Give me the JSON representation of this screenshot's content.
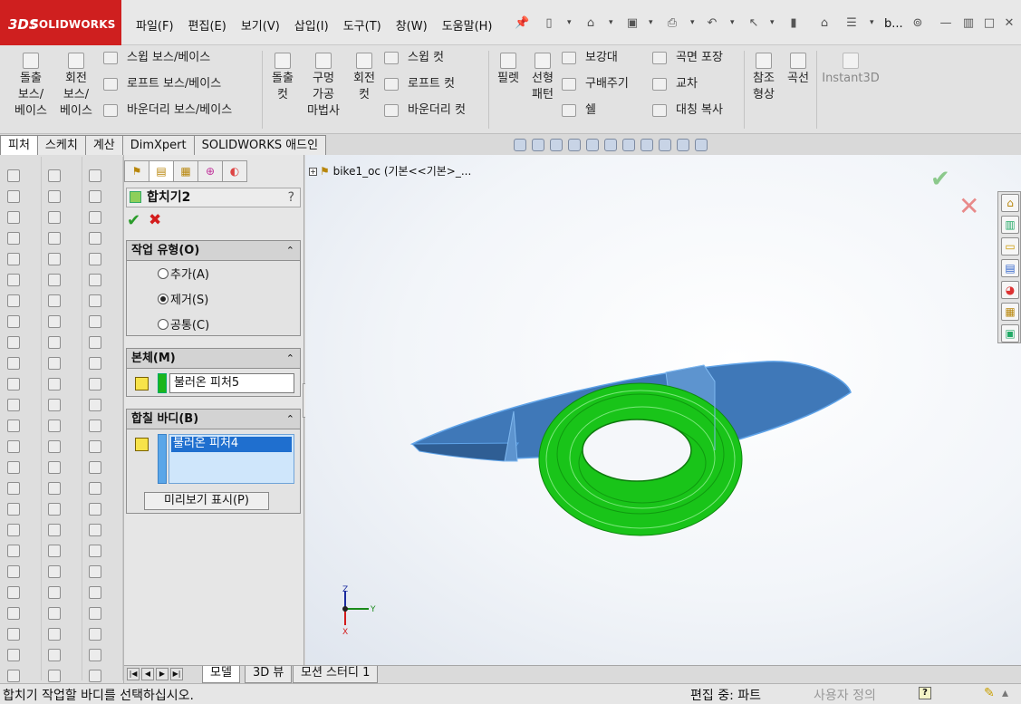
{
  "app": {
    "logo_mark": "3DS",
    "logo_text": "SOLIDWORKS",
    "doc_short": "b..."
  },
  "menu": [
    "파일(F)",
    "편집(E)",
    "보기(V)",
    "삽입(I)",
    "도구(T)",
    "창(W)",
    "도움말(H)"
  ],
  "commands": {
    "extrude_boss": "돌출\n보스/\n베이스",
    "revolve_boss": "회전\n보스/\n베이스",
    "sweep_boss": "스윕 보스/베이스",
    "loft_boss": "로프트 보스/베이스",
    "boundary_boss": "바운더리 보스/베이스",
    "extrude_cut": "돌출\n컷",
    "hole_wizard": "구멍\n가공\n마법사",
    "revolve_cut": "회전\n컷",
    "sweep_cut": "스윕 컷",
    "loft_cut": "로프트 컷",
    "boundary_cut": "바운더리 컷",
    "fillet": "필렛",
    "linear_pattern": "선형\n패턴",
    "rib": "보강대",
    "draft": "구배주기",
    "shell": "쉘",
    "wrap": "곡면 포장",
    "intersect": "교차",
    "mirror": "대칭 복사",
    "ref_geometry": "참조\n형상",
    "curves": "곡선",
    "instant3d": "Instant3D"
  },
  "command_tabs": [
    "피처",
    "스케치",
    "계산",
    "DimXpert",
    "SOLIDWORKS 애드인"
  ],
  "property_manager": {
    "title": "합치기2",
    "help": "?",
    "operation_type": {
      "header": "작업 유형(O)",
      "options": [
        "추가(A)",
        "제거(S)",
        "공통(C)"
      ],
      "selected": "제거(S)"
    },
    "main_body": {
      "header": "본체(M)",
      "value": "불러온 피처5"
    },
    "combine_bodies": {
      "header": "합칠 바디(B)",
      "value": "불러온 피처4"
    },
    "preview_button": "미리보기 표시(P)"
  },
  "graphics": {
    "tree_root": "bike1_oc  (기본<<기본>_...",
    "axes": {
      "x": "X",
      "y": "Y",
      "z": "Z"
    }
  },
  "bottom_tabs": [
    "모델",
    "3D 뷰",
    "모션 스터디 1"
  ],
  "status": {
    "message": "합치기 작업할 바디를 선택하십시오.",
    "mode": "편집 중: 파트",
    "custom": "사용자 정의",
    "help_icon": "?"
  },
  "colors": {
    "logo": "#cf1f1f",
    "body_blue": "#3f78b8",
    "torus_green": "#19c419",
    "ok": "#2a9c2a",
    "cancel": "#d31c1c"
  }
}
